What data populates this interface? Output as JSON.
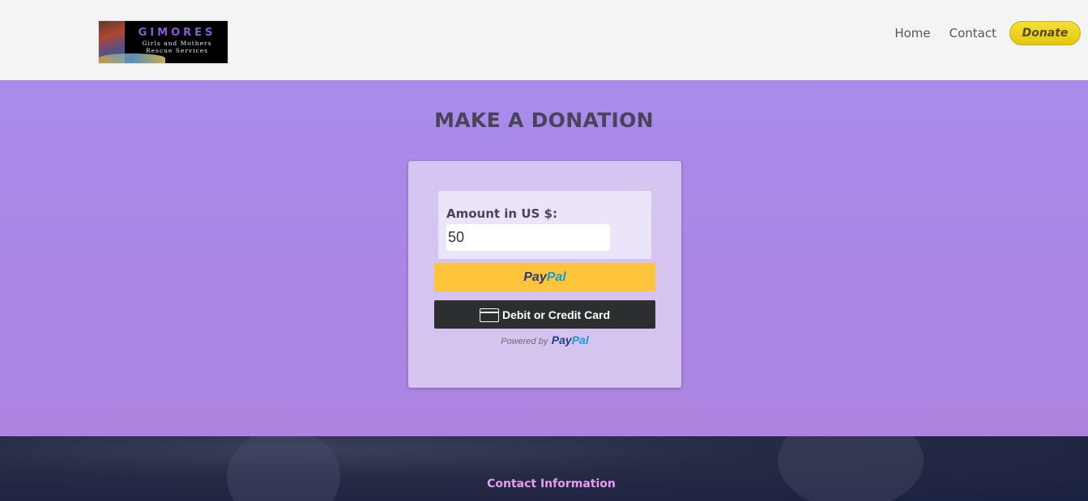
{
  "header": {
    "logo": {
      "title": "GIMORES",
      "line1": "Girls and Mothers",
      "line2": "Rescue Services"
    },
    "nav": {
      "home": "Home",
      "contact": "Contact",
      "donate": "Donate"
    }
  },
  "main": {
    "title": "MAKE A DONATION",
    "form": {
      "amount_label": "Amount in US $:",
      "amount_value": "50",
      "paypal_a": "Pay",
      "paypal_b": "Pal",
      "card_button": "Debit or Credit Card",
      "powered_by": "Powered by"
    }
  },
  "footer": {
    "title": "Contact Information"
  },
  "colors": {
    "hero_bg": "#a88ceb",
    "paypal_yellow": "#ffc439",
    "card_button_bg": "#2c2e2f",
    "donate_yellow": "#f3e03a",
    "footer_title": "#e79cf2"
  },
  "icons": [
    "credit-card-icon"
  ]
}
